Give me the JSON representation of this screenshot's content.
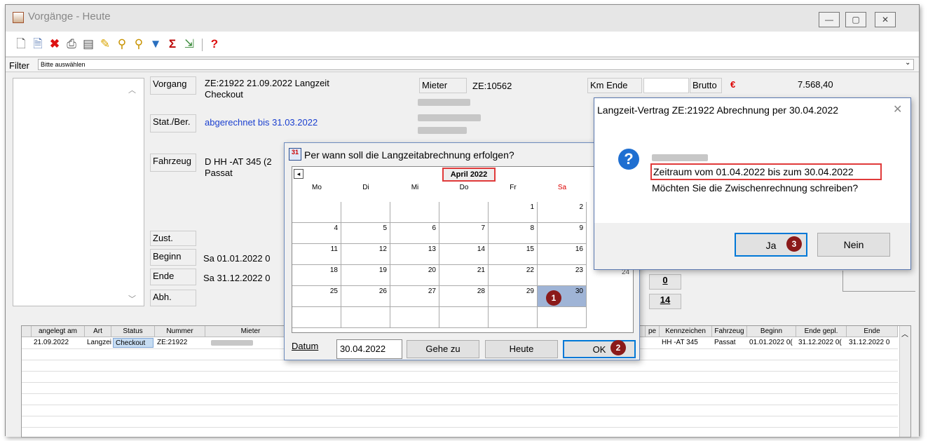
{
  "window": {
    "title": "Vorgänge - Heute",
    "minimize_icon": "minimize-icon",
    "maximize_icon": "maximize-icon",
    "close_icon": "close-icon"
  },
  "toolbar": {
    "icons": [
      "new-icon",
      "copy-icon",
      "delete-icon",
      "print-icon",
      "preview-icon",
      "edit-icon",
      "search-icon",
      "search-plus-icon",
      "filter-icon",
      "sum-icon",
      "export-icon",
      "help-icon"
    ]
  },
  "filter": {
    "label": "Filter",
    "value": "Bitte auswählen"
  },
  "detail": {
    "vorgang_label": "Vorgang",
    "vorgang_value_line1": "ZE:21922 21.09.2022 Langzeit",
    "vorgang_value_line2": "Checkout",
    "stat_label": "Stat./Ber.",
    "stat_value": "abgerechnet bis 31.03.2022",
    "fahrzeug_label": "Fahrzeug",
    "fahrzeug_value_line1": "D HH -AT 345 (2",
    "fahrzeug_value_line2": "Passat",
    "zust_label": "Zust.",
    "beginn_label": "Beginn",
    "beginn_value": "Sa  01.01.2022 0",
    "ende_label": "Ende",
    "ende_value": "Sa  31.12.2022 0",
    "abh_label": "Abh.",
    "mieter_label": "Mieter",
    "mieter_value": "ZE:10562",
    "km_ende_label": "Km Ende",
    "brutto_label": "Brutto",
    "currency": "€",
    "brutto_value": "7.568,40",
    "num_0": "0",
    "num_14": "14"
  },
  "grid": {
    "headers": [
      "angelegt am",
      "Art",
      "Status",
      "Nummer",
      "Mieter",
      "pe",
      "Kennzeichen",
      "Fahrzeug",
      "Beginn",
      "Ende gepl.",
      "Ende"
    ],
    "row": {
      "angelegt": "21.09.2022",
      "art": "Langzeit",
      "status": "Checkout",
      "nummer": "ZE:21922",
      "kennzeichen": "HH -AT 345",
      "fahrzeug": "Passat",
      "beginn": "01.01.2022 0(",
      "ende_gepl": "31.12.2022 0(",
      "ende": "31.12.2022 0"
    }
  },
  "calendar": {
    "title": "Per wann soll die Langzeitabrechnung erfolgen?",
    "month": "April 2022",
    "days": [
      "Mo",
      "Di",
      "Mi",
      "Do",
      "Fr",
      "Sa"
    ],
    "weeks": [
      [
        "",
        "",
        "",
        "",
        "1",
        "2"
      ],
      [
        "4",
        "5",
        "6",
        "7",
        "8",
        "9"
      ],
      [
        "11",
        "12",
        "13",
        "14",
        "15",
        "16"
      ],
      [
        "18",
        "19",
        "20",
        "21",
        "22",
        "23"
      ],
      [
        "25",
        "26",
        "27",
        "28",
        "29",
        "30"
      ],
      [
        "",
        "",
        "",
        "",
        "",
        ""
      ]
    ],
    "extra_24": "24",
    "datum_label": "Datum",
    "datum_value": "30.04.2022",
    "goto_label": "Gehe zu",
    "today_label": "Heute",
    "ok_label": "OK",
    "badge1": "1",
    "badge2": "2",
    "nav_prev": "◂"
  },
  "message": {
    "title": "Langzeit-Vertrag ZE:21922 Abrechnung per 30.04.2022",
    "line_range": "Zeitraum vom 01.04.2022 bis zum 30.04.2022",
    "line_question": "Möchten Sie die Zwischenrechnung schreiben?",
    "yes_label": "Ja",
    "no_label": "Nein",
    "badge3": "3",
    "icon": "question-icon"
  },
  "colors": {
    "accent_red": "#e03a3a",
    "badge": "#8b1a1a",
    "link_blue": "#1a3fcf",
    "selected_day": "#9fb4d6"
  }
}
